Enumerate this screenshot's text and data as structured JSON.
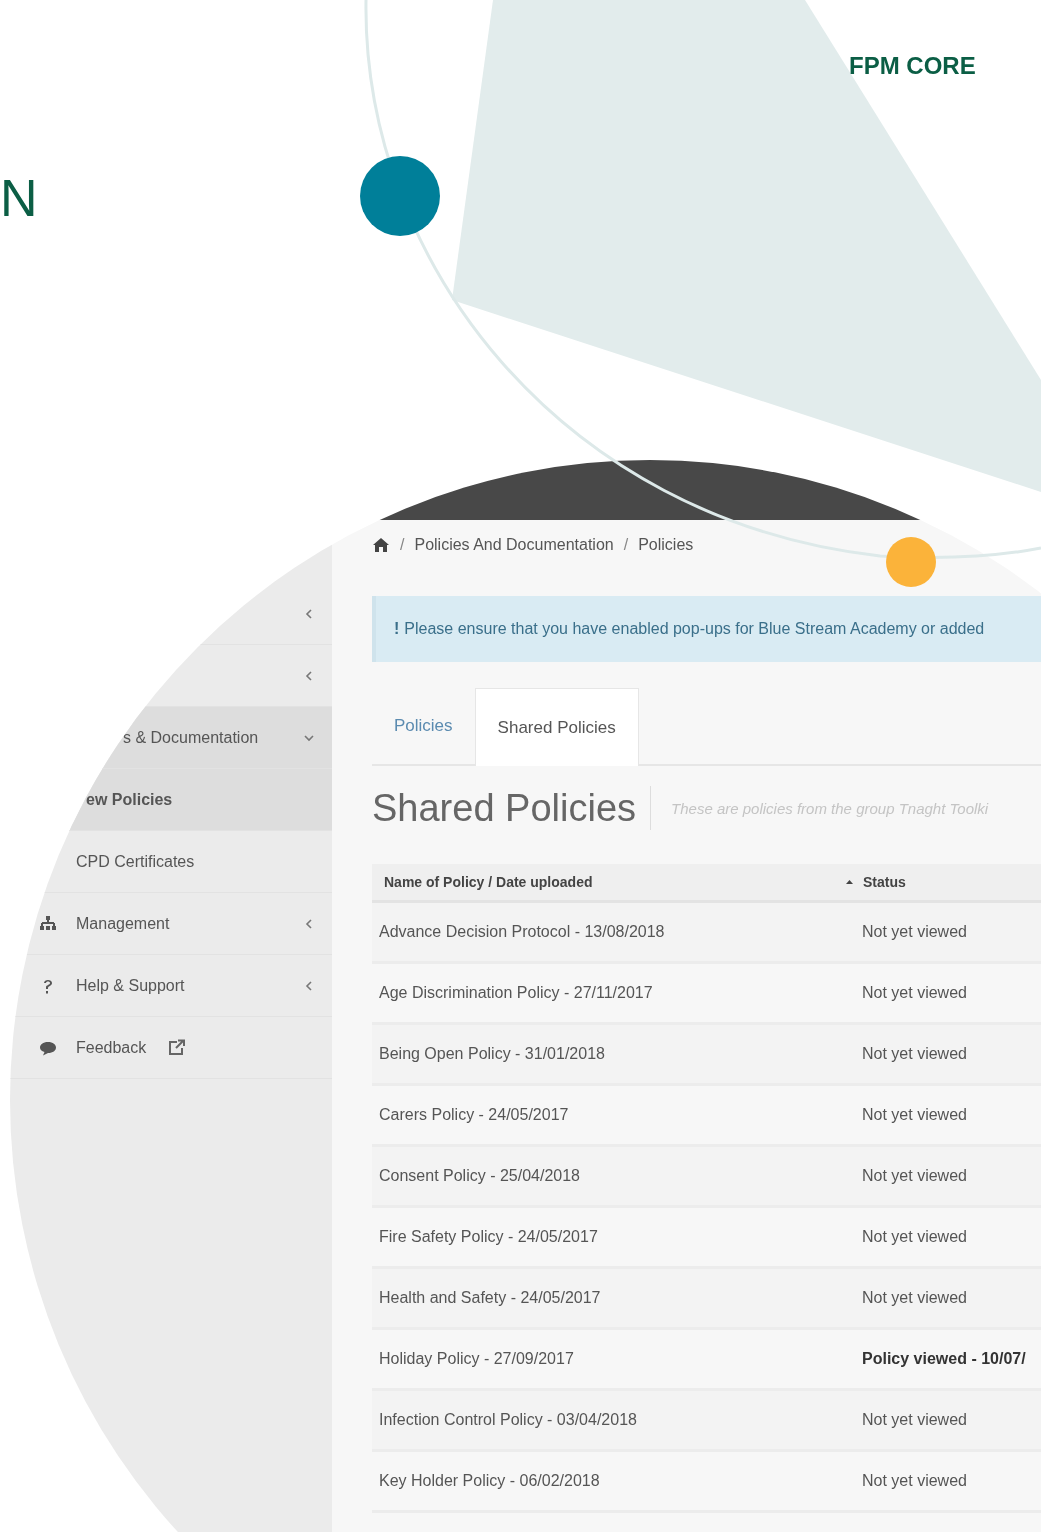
{
  "brand": {
    "heading_fragment": "N",
    "product": "FPM CORE"
  },
  "sidebar": {
    "items": [
      {
        "kind": "group",
        "expanded": false,
        "selected": false
      },
      {
        "kind": "group",
        "expanded": false,
        "selected": false
      },
      {
        "kind": "group",
        "label": "s & Documentation",
        "expanded": true,
        "selected": true
      },
      {
        "kind": "sub",
        "label": "ew Policies",
        "selected": true
      },
      {
        "kind": "sub",
        "label": "CPD Certificates",
        "selected": false
      },
      {
        "kind": "group",
        "label": "Management",
        "expanded": false,
        "selected": false
      },
      {
        "kind": "group",
        "label": "Help & Support",
        "expanded": false,
        "selected": false
      },
      {
        "kind": "link",
        "label": "Feedback",
        "external": true,
        "selected": false
      }
    ]
  },
  "breadcrumb": [
    {
      "separator": "/",
      "label": "Policies And Documentation"
    },
    {
      "separator": "/",
      "label": "Policies"
    }
  ],
  "alert": "**!** Please ensure that you have enabled pop-ups for Blue Stream Academy or added",
  "tabs": [
    {
      "label": "Policies",
      "selected": false
    },
    {
      "label": "Shared Policies",
      "selected": true
    }
  ],
  "page": {
    "title": "Shared Policies",
    "subtitle": "These are policies from the group Tnaght Toolki"
  },
  "table": {
    "columns": [
      "Name of Policy / Date uploaded",
      "Status"
    ],
    "rows": [
      {
        "name": "Advance Decision Protocol - 13/08/2018",
        "status": "Not yet viewed",
        "viewed": false
      },
      {
        "name": "Age Discrimination Policy - 27/11/2017",
        "status": "Not yet viewed",
        "viewed": false
      },
      {
        "name": "Being Open Policy - 31/01/2018",
        "status": "Not yet viewed",
        "viewed": false
      },
      {
        "name": "Carers Policy - 24/05/2017",
        "status": "Not yet viewed",
        "viewed": false
      },
      {
        "name": "Consent Policy - 25/04/2018",
        "status": "Not yet viewed",
        "viewed": false
      },
      {
        "name": "Fire Safety Policy - 24/05/2017",
        "status": "Not yet viewed",
        "viewed": false
      },
      {
        "name": "Health and Safety - 24/05/2017",
        "status": "Not yet viewed",
        "viewed": false
      },
      {
        "name": "Holiday Policy - 27/09/2017",
        "status": "Policy viewed - 10/07/",
        "viewed": true
      },
      {
        "name": "Infection Control Policy - 03/04/2018",
        "status": "Not yet viewed",
        "viewed": false
      },
      {
        "name": "Key Holder Policy - 06/02/2018",
        "status": "Not yet viewed",
        "viewed": false
      }
    ]
  }
}
